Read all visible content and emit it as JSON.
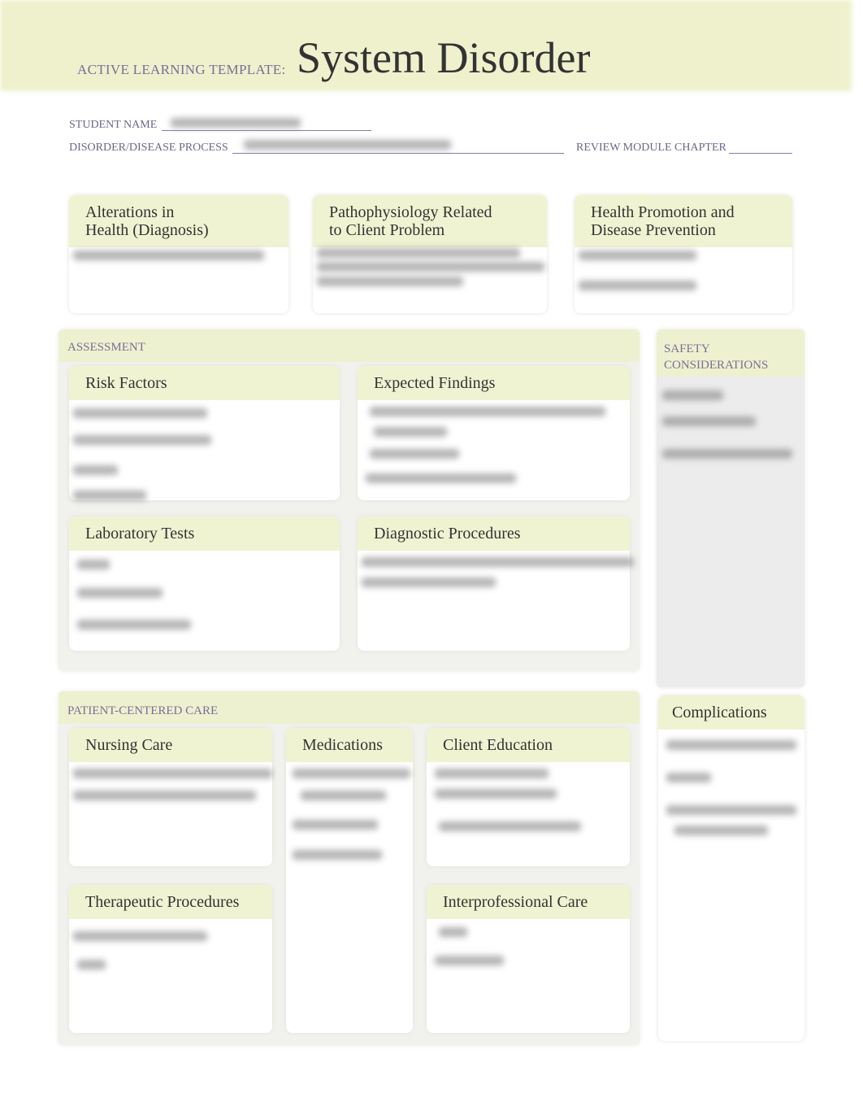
{
  "header": {
    "template_label": "ACTIVE LEARNING TEMPLATE:",
    "title": "System Disorder"
  },
  "fields": {
    "student_name": "STUDENT NAME",
    "disorder": "DISORDER/DISEASE PROCESS",
    "review_module": "REVIEW MODULE CHAPTER"
  },
  "top_boxes": [
    "Alterations in\nHealth (Diagnosis)",
    "Pathophysiology Related\nto Client Problem",
    "Health Promotion and\nDisease Prevention"
  ],
  "assessment": {
    "label": "ASSESSMENT",
    "risk_factors": "Risk Factors",
    "expected_findings": "Expected Findings",
    "laboratory_tests": "Laboratory Tests",
    "diagnostic_procedures": "Diagnostic Procedures"
  },
  "safety": {
    "label": "SAFETY\nCONSIDERATIONS"
  },
  "patient_care": {
    "label": "PATIENT-CENTERED CARE",
    "nursing_care": "Nursing Care",
    "medications": "Medications",
    "client_education": "Client Education",
    "therapeutic_procedures": "Therapeutic Procedures",
    "interprofessional_care": "Interprofessional Care"
  },
  "complications": {
    "label": "Complications"
  },
  "colors": {
    "accent_purple": "#7b6d98",
    "header_band": "#eef1cc",
    "box_header": "#f0f3d2"
  }
}
